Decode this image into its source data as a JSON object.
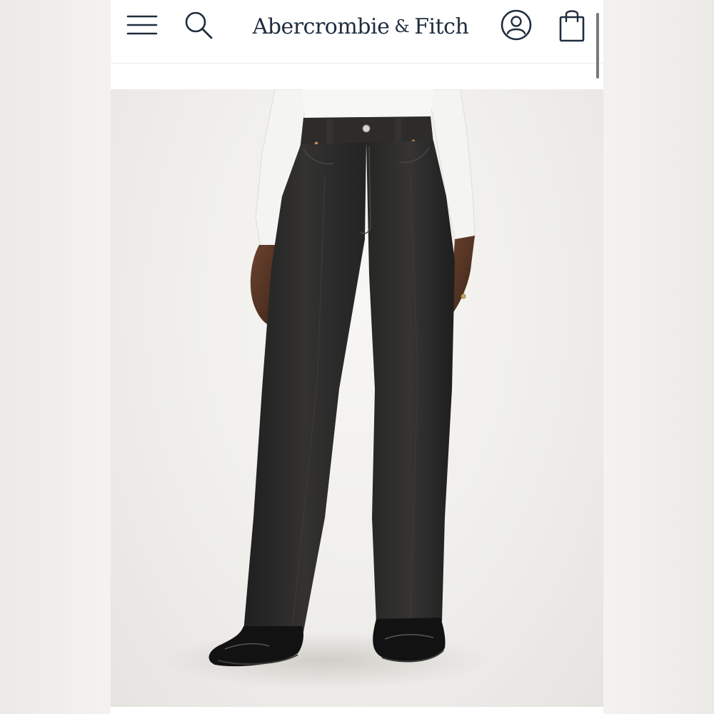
{
  "header": {
    "brand_name": "Abercrombie",
    "brand_amp": "&",
    "brand_name_2": "Fitch",
    "icons": {
      "menu": "hamburger-menu-icon",
      "search": "search-icon",
      "account": "user-account-icon",
      "bag": "shopping-bag-icon"
    }
  },
  "product": {
    "image": "product-photo"
  },
  "colors": {
    "brand_text": "#1f2d3d",
    "denim": "#2a2a2a",
    "background": "#efeeeb"
  }
}
